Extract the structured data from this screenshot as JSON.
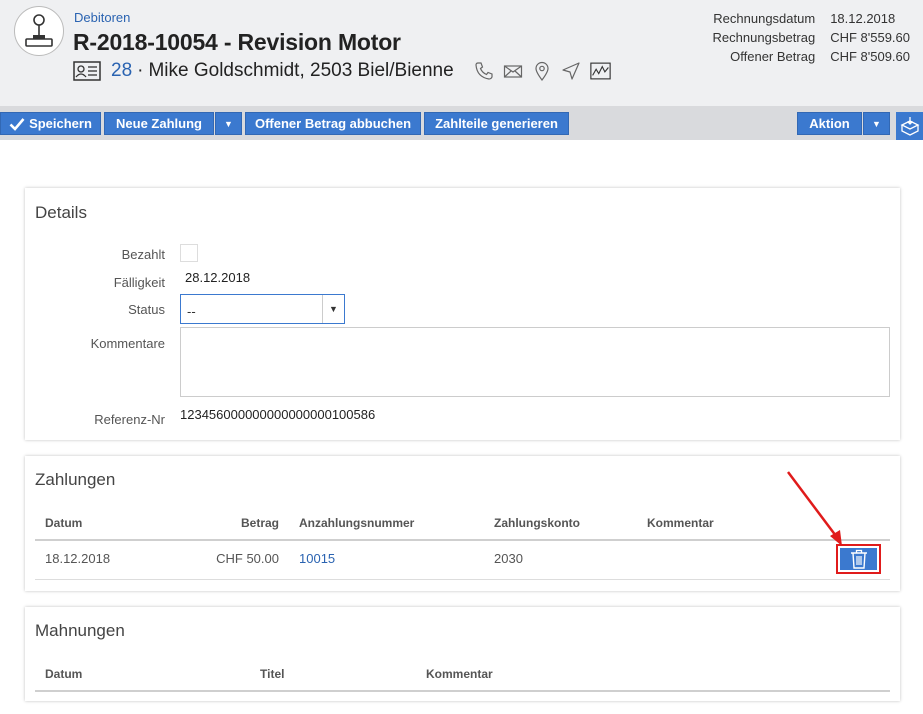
{
  "header": {
    "breadcrumb": "Debitoren",
    "title": "R-2018-10054 - Revision Motor",
    "contact_number": "28",
    "contact_separator": "·",
    "contact_name": "Mike Goldschmidt, 2503 Biel/Bienne",
    "summary": [
      {
        "label": "Rechnungsdatum",
        "value": "18.12.2018"
      },
      {
        "label": "Rechnungsbetrag",
        "value": "CHF 8'559.60"
      },
      {
        "label": "Offener Betrag",
        "value": "CHF 8'509.60"
      }
    ]
  },
  "toolbar": {
    "save_label": "Speichern",
    "new_payment_label": "Neue Zahlung",
    "write_off_label": "Offener Betrag abbuchen",
    "generate_label": "Zahlteile generieren",
    "action_label": "Aktion",
    "caret": "▼"
  },
  "details": {
    "title": "Details",
    "paid_label": "Bezahlt",
    "due_label": "Fälligkeit",
    "due_value": "28.12.2018",
    "status_label": "Status",
    "status_value": "--",
    "comments_label": "Kommentare",
    "reference_label": "Referenz-Nr",
    "reference_value": "123456000000000000000100586"
  },
  "payments": {
    "title": "Zahlungen",
    "columns": {
      "date": "Datum",
      "amount": "Betrag",
      "deposit_no": "Anzahlungsnummer",
      "account": "Zahlungskonto",
      "comment": "Kommentar"
    },
    "rows": [
      {
        "date": "18.12.2018",
        "amount": "CHF 50.00",
        "deposit_no": "10015",
        "account": "2030",
        "comment": ""
      }
    ]
  },
  "reminders": {
    "title": "Mahnungen",
    "columns": {
      "date": "Datum",
      "title": "Titel",
      "comment": "Kommentar"
    }
  },
  "colors": {
    "accent": "#3b79cf",
    "link": "#2a63b1",
    "highlight": "#e01b1b",
    "header_bg": "#eff0f2"
  }
}
